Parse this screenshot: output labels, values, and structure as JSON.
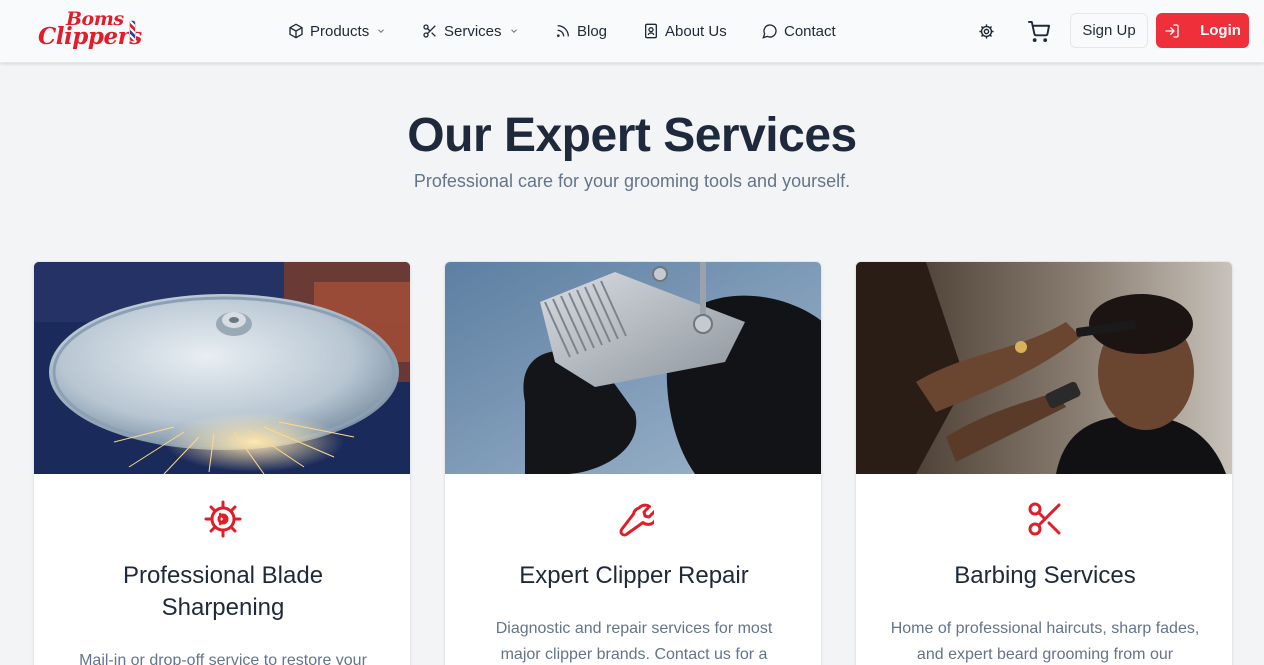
{
  "brand": {
    "logo_line1": "Boms",
    "logo_line2": "Clippers"
  },
  "nav": {
    "products": "Products",
    "services": "Services",
    "blog": "Blog",
    "about": "About Us",
    "contact": "Contact"
  },
  "header_actions": {
    "signup": "Sign Up",
    "login": "Login"
  },
  "hero": {
    "title": "Our Expert Services",
    "subtitle": "Professional care for your grooming tools and yourself."
  },
  "services": [
    {
      "icon": "gear-icon",
      "title": "Professional Blade Sharpening",
      "description": "Mail-in or drop-off service to restore your"
    },
    {
      "icon": "wrench-icon",
      "title": "Expert Clipper Repair",
      "description": "Diagnostic and repair services for most major clipper brands. Contact us for a"
    },
    {
      "icon": "scissors-icon",
      "title": "Barbing Services",
      "description": "Home of professional haircuts, sharp fades, and expert beard grooming from our"
    }
  ],
  "colors": {
    "accent": "#ef2f3a",
    "heading": "#1e293b",
    "muted": "#64748b",
    "background": "#f3f4f6"
  }
}
